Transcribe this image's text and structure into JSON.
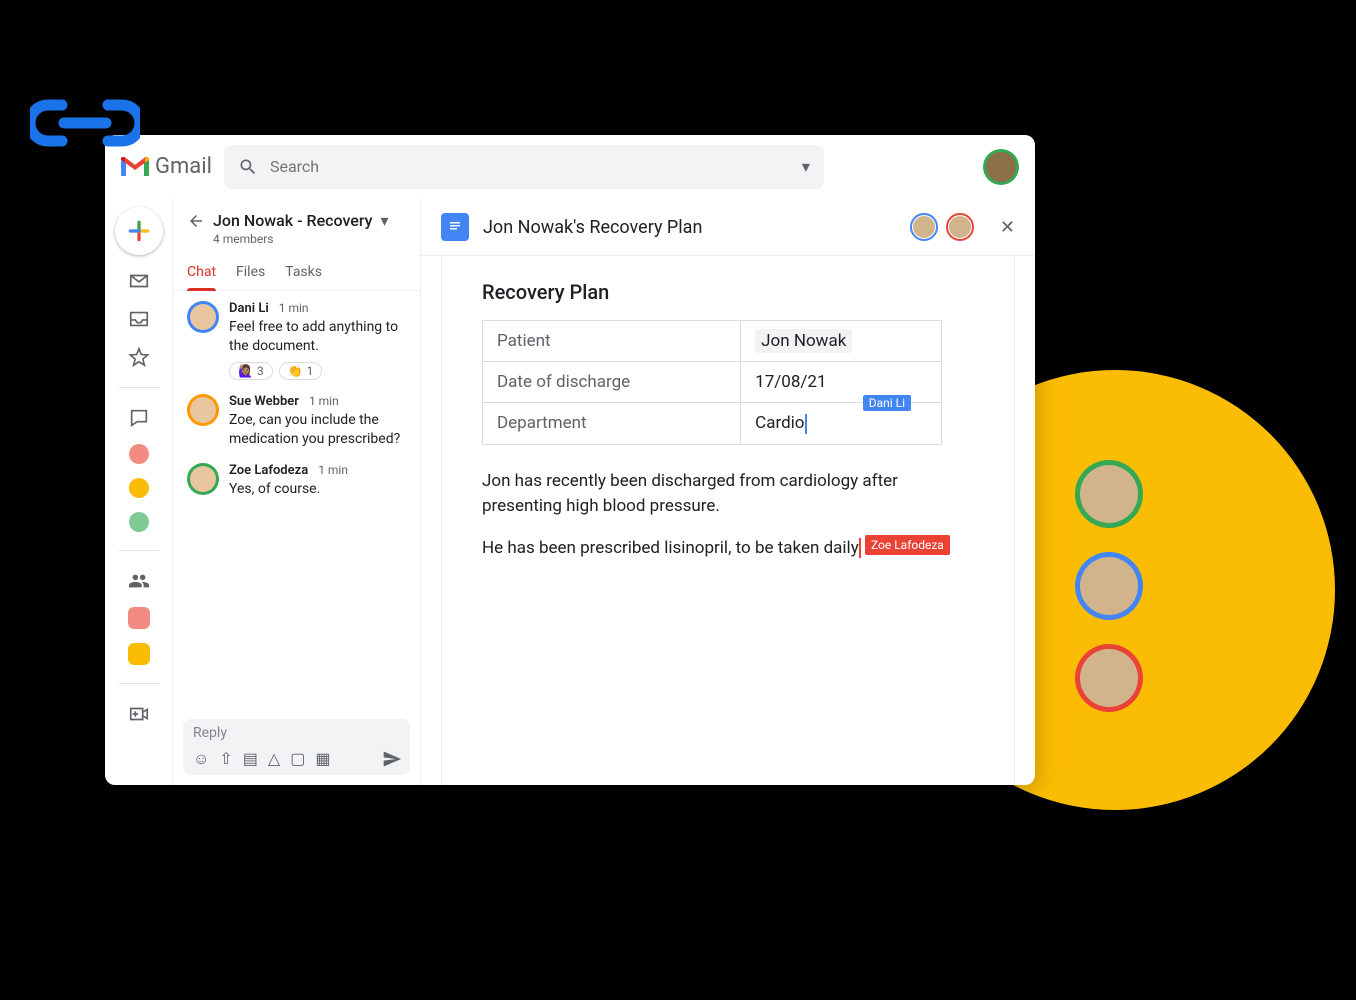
{
  "header": {
    "brand": "Gmail",
    "search_placeholder": "Search"
  },
  "rail": {
    "compose": "compose"
  },
  "chat": {
    "room_title": "Jon Nowak - Recovery",
    "member_count": "4 members",
    "tabs": {
      "chat": "Chat",
      "files": "Files",
      "tasks": "Tasks"
    },
    "messages": [
      {
        "name": "Dani Li",
        "time": "1 min",
        "text": "Feel free to add anything to the document.",
        "reactions": [
          {
            "emoji": "🙋🏽‍♀️",
            "count": "3"
          },
          {
            "emoji": "👏",
            "count": "1"
          }
        ]
      },
      {
        "name": "Sue Webber",
        "time": "1 min",
        "text": "Zoe, can you include the medication you prescribed?"
      },
      {
        "name": "Zoe Lafodeza",
        "time": "1 min",
        "text": "Yes, of course."
      }
    ],
    "reply_placeholder": "Reply"
  },
  "doc": {
    "title": "Jon Nowak's Recovery Plan",
    "heading": "Recovery Plan",
    "table": {
      "patient_label": "Patient",
      "patient_value": "Jon Nowak",
      "discharge_label": "Date of discharge",
      "discharge_value": "17/08/21",
      "dept_label": "Department",
      "dept_value": "Cardio"
    },
    "cursor1_name": "Dani Li",
    "para1": "Jon has recently been discharged from cardiology after presenting high blood pressure.",
    "para2a": "He has been prescribed lisinopril, to be taken daily",
    "cursor2_name": "Zoe Lafodeza"
  }
}
